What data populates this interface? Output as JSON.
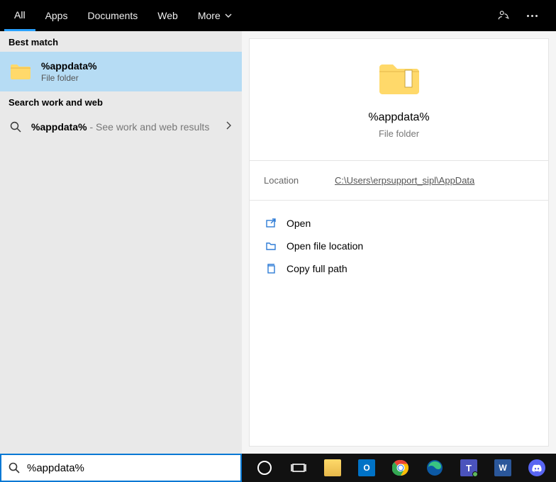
{
  "tabs": {
    "all": "All",
    "apps": "Apps",
    "documents": "Documents",
    "web": "Web",
    "more": "More"
  },
  "left": {
    "best_match_header": "Best match",
    "best_match": {
      "title": "%appdata%",
      "sub": "File folder"
    },
    "section2_header": "Search work and web",
    "web_result": {
      "query": "%appdata%",
      "suffix": " - See work and web results"
    }
  },
  "detail": {
    "title": "%appdata%",
    "sub": "File folder",
    "location_label": "Location",
    "location_value": "C:\\Users\\erpsupport_sipl\\AppData",
    "actions": {
      "open": "Open",
      "open_location": "Open file location",
      "copy_path": "Copy full path"
    }
  },
  "search": {
    "value": "%appdata%"
  },
  "taskbar_icons": [
    "cortana",
    "taskview",
    "file-explorer",
    "outlook",
    "chrome",
    "edge",
    "teams",
    "word",
    "discord"
  ]
}
